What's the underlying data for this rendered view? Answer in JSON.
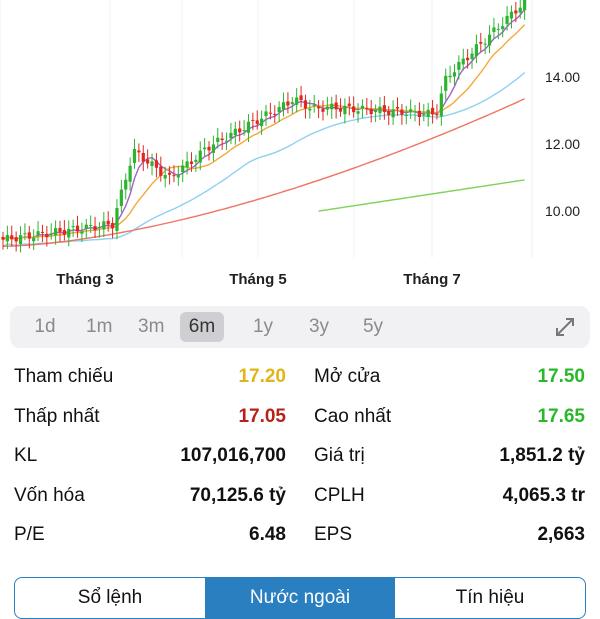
{
  "chart_data": {
    "type": "candlestick",
    "y_ticks": [
      "14.00",
      "12.00",
      "10.00"
    ],
    "x_ticks": [
      "Tháng 3",
      "Tháng 5",
      "Tháng 7"
    ],
    "ylim": [
      8.6,
      16.3
    ],
    "colors": {
      "up": "#2bb52f",
      "down": "#e0281f",
      "ma_short": "#a461c7",
      "ma_mid": "#f2a93b",
      "ma_long": "#8fd0f2",
      "ma_longer": "#f07462",
      "ma_longest": "#7fd15a"
    }
  },
  "ranges": [
    "1d",
    "1m",
    "3m",
    "6m",
    "1y",
    "3y",
    "5y"
  ],
  "active_range": "6m",
  "stats": {
    "rows": [
      {
        "l_label": "Tham chiếu",
        "l_value": "17.20",
        "l_color": "#e0b51a",
        "r_label": "Mở cửa",
        "r_value": "17.50",
        "r_color": "#28b828"
      },
      {
        "l_label": "Thấp nhất",
        "l_value": "17.05",
        "l_color": "#b8211b",
        "r_label": "Cao nhất",
        "r_value": "17.65",
        "r_color": "#28b828"
      },
      {
        "l_label": "KL",
        "l_value": "107,016,700",
        "l_color": "#111111",
        "r_label": "Giá trị",
        "r_value": "1,851.2 tỷ",
        "r_color": "#111111"
      },
      {
        "l_label": "Vốn hóa",
        "l_value": "70,125.6 tỷ",
        "l_color": "#111111",
        "r_label": "CPLH",
        "r_value": "4,065.3 tr",
        "r_color": "#111111"
      },
      {
        "l_label": "P/E",
        "l_value": "6.48",
        "l_color": "#111111",
        "r_label": "EPS",
        "r_value": "2,663",
        "r_color": "#111111"
      }
    ]
  },
  "tabs": [
    "Sổ lệnh",
    "Nước ngoài",
    "Tín hiệu"
  ],
  "active_tab": "Nước ngoài"
}
